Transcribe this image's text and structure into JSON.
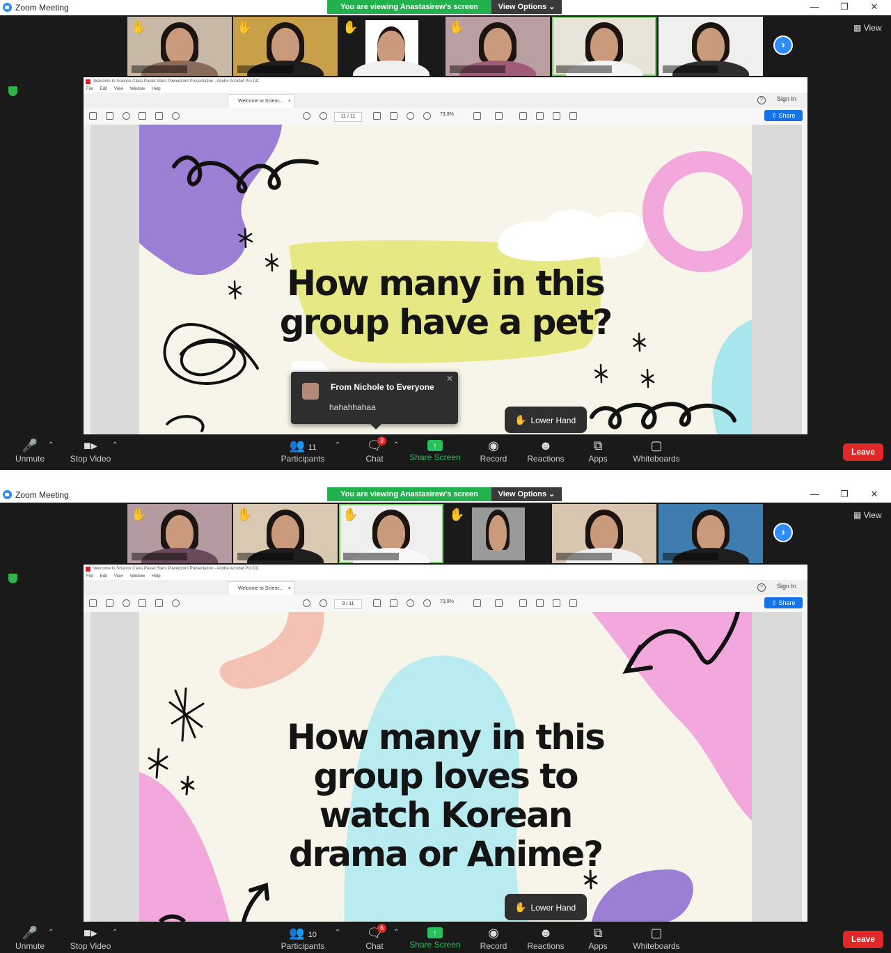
{
  "app_title": "Zoom Meeting",
  "banner": "You are viewing Anastasirew's screen",
  "view_options": "View Options ⌄",
  "view_label": "View",
  "acrobat_title": "Welcome to Science Class Pastel Stars Powerpoint Presentation - Adobe Acrobat Pro DC",
  "menu": [
    "File",
    "Edit",
    "View",
    "Window",
    "Help"
  ],
  "doc_tab": "Welcome to Scienc...",
  "sign_in": "Sign In",
  "share": "Share",
  "zoom_level": "73,9%",
  "toolbar": {
    "unmute": "Unmute",
    "stop_video": "Stop Video",
    "participants": "Participants",
    "chat": "Chat",
    "share_screen": "Share Screen",
    "record": "Record",
    "reactions": "Reactions",
    "apps": "Apps",
    "whiteboards": "Whiteboards",
    "leave": "Leave"
  },
  "lower_hand": "Lower Hand",
  "icons": {
    "mic": "mic-muted-icon",
    "video": "video-camera-icon",
    "participants": "participants-icon",
    "chat": "chat-bubble-icon",
    "share": "share-arrow-icon",
    "record": "record-icon",
    "reactions": "smiley-icon",
    "apps": "apps-icon",
    "whiteboards": "whiteboard-icon",
    "hand": "raised-hand-icon"
  },
  "colors": {
    "accent": "#2d8cff",
    "banner_green": "#23b14d",
    "leave_red": "#e02828"
  },
  "windows": [
    {
      "page": "11 / 11",
      "participants_count": "11",
      "chat_badge": "3",
      "slide_title_lines": [
        "How many in this",
        "group have a pet?"
      ],
      "chat_popup": {
        "from": "From Nichole to Everyone",
        "message": "hahahhahaa"
      }
    },
    {
      "page": "9 / 11",
      "participants_count": "10",
      "chat_badge": "6",
      "slide_title_lines": [
        "How many in this",
        "group loves to",
        "watch Korean",
        "drama or Anime?"
      ]
    }
  ]
}
